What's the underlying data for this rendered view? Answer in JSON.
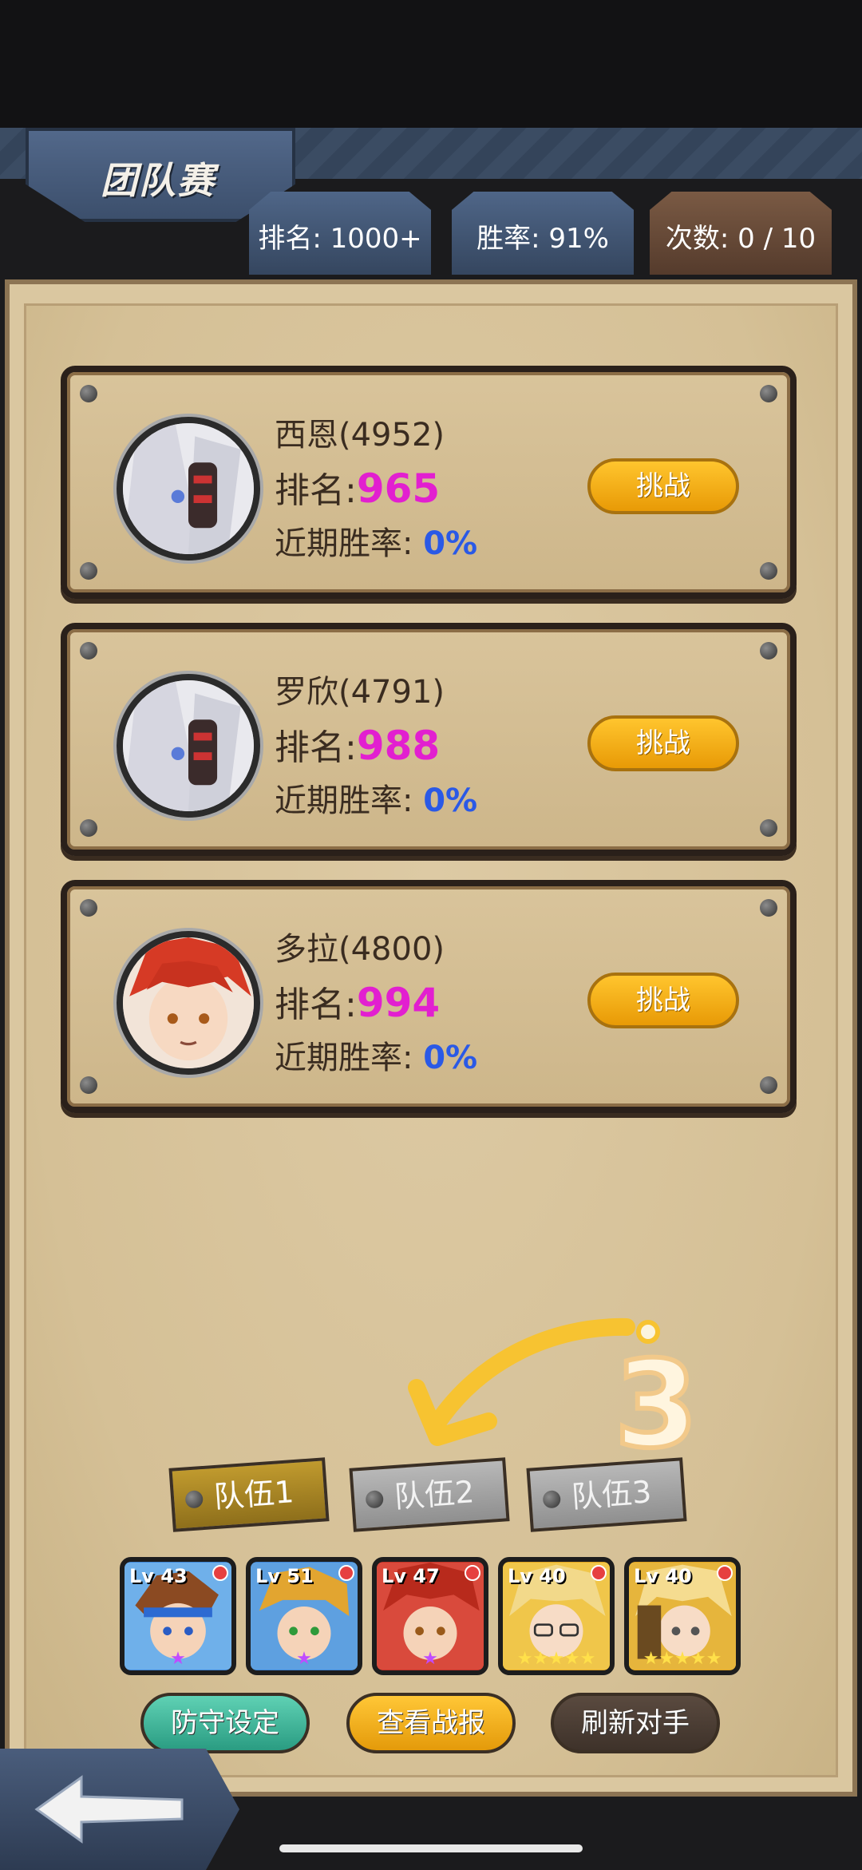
{
  "header": {
    "title": "团队赛",
    "stats": [
      {
        "label": "排名: 1000+"
      },
      {
        "label": "胜率: 91%"
      },
      {
        "label": "次数: 0 / 10"
      }
    ]
  },
  "opponents": [
    {
      "name": "西恩(4952)",
      "rank_label": "排名:",
      "rank": "965",
      "rate_label": "近期胜率:",
      "rate": "0%",
      "button": "挑战"
    },
    {
      "name": "罗欣(4791)",
      "rank_label": "排名:",
      "rank": "988",
      "rate_label": "近期胜率:",
      "rate": "0%",
      "button": "挑战"
    },
    {
      "name": "多拉(4800)",
      "rank_label": "排名:",
      "rank": "994",
      "rate_label": "近期胜率:",
      "rate": "0%",
      "button": "挑战"
    }
  ],
  "annotation": {
    "step": "3"
  },
  "teams": [
    {
      "label": "队伍1",
      "active": true
    },
    {
      "label": "队伍2",
      "active": false
    },
    {
      "label": "队伍3",
      "active": false
    }
  ],
  "heroes": [
    {
      "level": "Lv 43",
      "stars": "★"
    },
    {
      "level": "Lv 51",
      "stars": "★"
    },
    {
      "level": "Lv 47",
      "stars": "★"
    },
    {
      "level": "Lv 40",
      "stars": "★★★★★"
    },
    {
      "level": "Lv 40",
      "stars": "★★★★★"
    }
  ],
  "actions": {
    "defense": "防守设定",
    "report": "查看战报",
    "refresh": "刷新对手"
  },
  "colors": {
    "rank_number": "#e21fd0",
    "win_rate": "#2a59e6",
    "challenge_button": "#f5b01c"
  }
}
